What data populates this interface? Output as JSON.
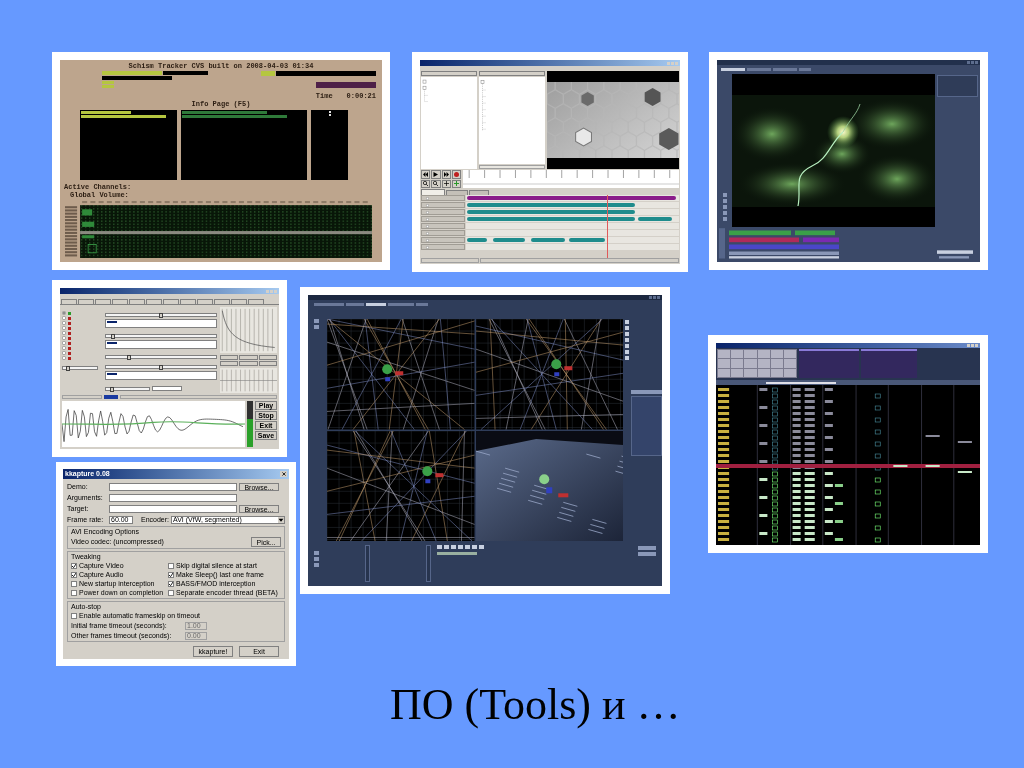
{
  "slide": {
    "title": "ПО (Tools) и …"
  },
  "screenshots": [
    {
      "kind": "tracker",
      "title": "Schism Tracker CVS built on 2008-04-03 01:34",
      "time_label": "Time",
      "time": "0:00:21",
      "info_page": "Info Page (F5)",
      "active_channels": "Active Channels:",
      "global_volume": "Global Volume:"
    },
    {
      "kind": "timeline",
      "tabs": [
        {
          "selected": true
        },
        {
          "selected": false
        },
        {
          "selected": false
        }
      ]
    },
    {
      "kind": "viewer",
      "tabs": [
        {
          "selected": true
        },
        {
          "selected": false
        },
        {
          "selected": false
        },
        {
          "selected": false
        }
      ]
    },
    {
      "kind": "synth",
      "oscillators": [
        {
          "selected": true,
          "active": true
        },
        {
          "selected": false,
          "active": false
        },
        {
          "selected": false,
          "active": false
        },
        {
          "selected": false,
          "active": false
        },
        {
          "selected": false,
          "active": false
        },
        {
          "selected": false,
          "active": false
        },
        {
          "selected": false,
          "active": false
        },
        {
          "selected": false,
          "active": false
        },
        {
          "selected": false,
          "active": false
        },
        {
          "selected": false,
          "active": false
        }
      ],
      "sliders": [
        {
          "level": 0.1
        },
        {
          "level": 0.5
        },
        {
          "level": 0.05
        },
        {
          "level": 0.2
        },
        {
          "level": 0.5
        },
        {
          "level": 0.1
        }
      ],
      "meter": {
        "level": 0.6
      },
      "buttons": [
        "Play",
        "Stop",
        "Exit",
        "Save"
      ]
    },
    {
      "kind": "modeler",
      "tabs": [
        {
          "selected": false
        },
        {
          "selected": false
        },
        {
          "selected": true
        },
        {
          "selected": false
        },
        {
          "selected": false
        }
      ]
    },
    {
      "kind": "sequencer"
    },
    {
      "kind": "dialog",
      "title": "kkapture 0.08",
      "fields": [
        {
          "label": "Demo:",
          "button": "Browse..."
        },
        {
          "label": "Arguments:"
        },
        {
          "label": "Target:",
          "button": "Browse..."
        }
      ],
      "frame_rate": {
        "label": "Frame rate:",
        "value": "60.00"
      },
      "encoder": {
        "label": "Encoder:",
        "value": "AVI (VfW, segmented)"
      },
      "avi_options": {
        "title": "AVI Encoding Options",
        "codec": "Video codec: (uncompressed)",
        "button": "Pick..."
      },
      "tweaking": {
        "title": "Tweaking",
        "options": [
          {
            "label": "Capture Video",
            "checked": true
          },
          {
            "label": "Skip digital silence at start",
            "checked": false
          },
          {
            "label": "Capture Audio",
            "checked": true
          },
          {
            "label": "Make Sleep() last one frame",
            "checked": true
          },
          {
            "label": "New startup interception",
            "checked": false
          },
          {
            "label": "BASS/FMOD interception",
            "checked": true
          },
          {
            "label": "Power down on completion",
            "checked": false
          },
          {
            "label": "Separate encoder thread (BETA)",
            "checked": false
          }
        ]
      },
      "auto_stop": {
        "title": "Auto-stop",
        "option": {
          "label": "Enable automatic frameskip on timeout",
          "checked": false
        },
        "timeouts": [
          {
            "label": "Initial frame timeout (seconds):",
            "value": "1.00",
            "disabled": true
          },
          {
            "label": "Other frames timeout (seconds):",
            "value": "0.00",
            "disabled": true
          }
        ]
      },
      "buttons": [
        "kkapture!",
        "Exit"
      ]
    }
  ]
}
